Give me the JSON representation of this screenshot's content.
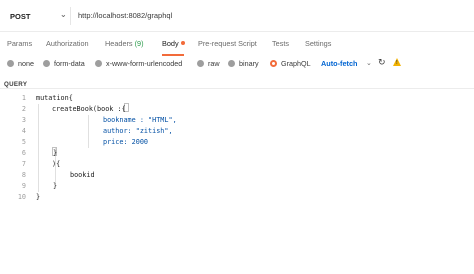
{
  "request": {
    "method": "POST",
    "url": "http://localhost:8082/graphql"
  },
  "tabs": [
    {
      "label": "Params"
    },
    {
      "label": "Authorization"
    },
    {
      "label": "Headers",
      "count": "(9)"
    },
    {
      "label": "Body"
    },
    {
      "label": "Pre-request Script"
    },
    {
      "label": "Tests"
    },
    {
      "label": "Settings"
    }
  ],
  "body_types": [
    {
      "label": "none"
    },
    {
      "label": "form-data"
    },
    {
      "label": "x-www-form-urlencoded"
    },
    {
      "label": "raw"
    },
    {
      "label": "binary"
    },
    {
      "label": "GraphQL"
    }
  ],
  "selected_body_type": "GraphQL",
  "auto_fetch": "Auto-fetch",
  "query_label": "QUERY",
  "code_lines": [
    {
      "n": "1",
      "text": "mutation{"
    },
    {
      "n": "2",
      "text": "createBook(book :{"
    },
    {
      "n": "3",
      "text": "bookname : \"HTML\","
    },
    {
      "n": "4",
      "text": "author: \"zitish\","
    },
    {
      "n": "5",
      "text": "price: 2000"
    },
    {
      "n": "6",
      "text": "}"
    },
    {
      "n": "7",
      "text": "){"
    },
    {
      "n": "8",
      "text": "bookid"
    },
    {
      "n": "9",
      "text": "}"
    },
    {
      "n": "10",
      "text": "}"
    }
  ],
  "colors": {
    "accent": "#f26b3a",
    "link": "#0265d2",
    "count": "#2a9a4a"
  }
}
